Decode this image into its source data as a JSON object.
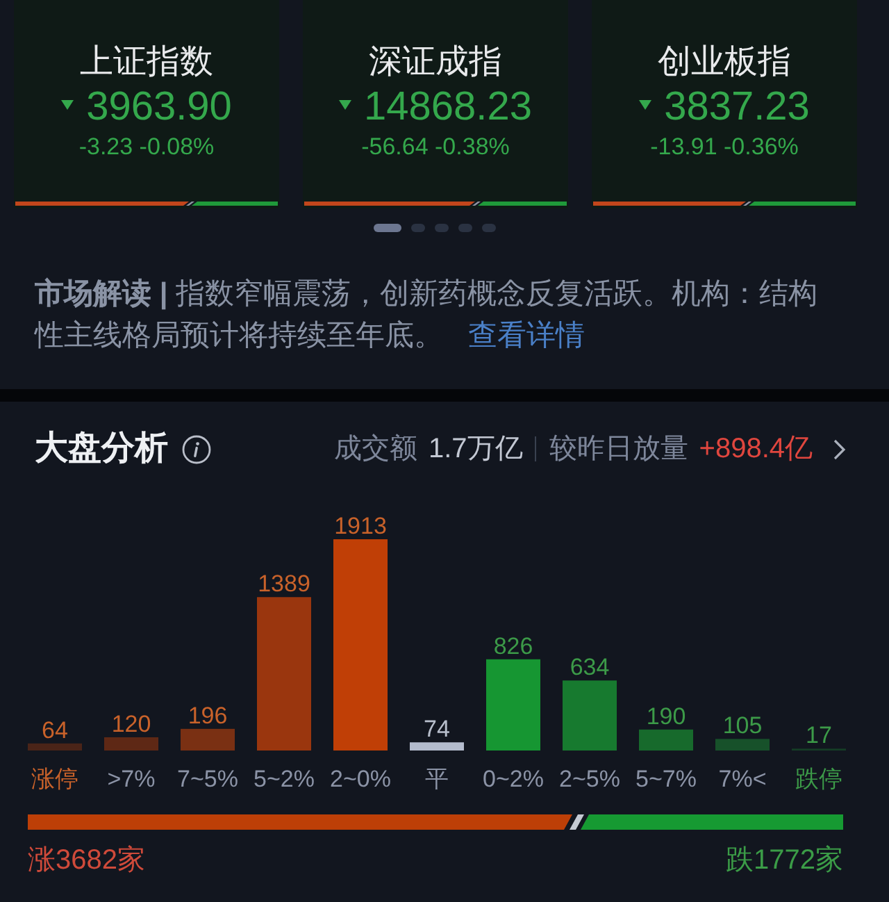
{
  "index_cards": [
    {
      "name": "上证指数",
      "value": "3963.90",
      "change": "-3.23 -0.08%",
      "falling": true,
      "level": 0.66
    },
    {
      "name": "深证成指",
      "value": "14868.23",
      "change": "-56.64 -0.38%",
      "falling": true,
      "level": 0.65
    },
    {
      "name": "创业板指",
      "value": "3837.23",
      "change": "-13.91 -0.36%",
      "falling": true,
      "level": 0.58
    }
  ],
  "pager": [
    {
      "selected": true
    },
    {
      "selected": false
    },
    {
      "selected": false
    },
    {
      "selected": false
    },
    {
      "selected": false
    }
  ],
  "market_commentary": {
    "text": "**市场解读 |** 指数窄幅震荡，创新药概念反复活跃。机构：结构性主线格局预计将持续至年底。",
    "link": "查看详情"
  },
  "market_analysis": {
    "title": "大盘分析",
    "turnover_label": "成交额",
    "turnover": "1.7万亿",
    "change_label": "较昨日放量",
    "change": "+898.4亿",
    "chart_data": {
      "type": "bar",
      "categories": [
        "涨停",
        ">7%",
        "7~5%",
        "5~2%",
        "2~0%",
        "平",
        "0~2%",
        "2~5%",
        "5~7%",
        "7%<",
        "跌停"
      ],
      "values": [
        64,
        120,
        196,
        1389,
        1913,
        74,
        826,
        634,
        190,
        105,
        17
      ],
      "data_labels": true
    },
    "bars": [
      {
        "kind": "up",
        "color": "#4a2418",
        "highlight": true
      },
      {
        "kind": "up",
        "color": "#5e2815",
        "highlight": false
      },
      {
        "kind": "up",
        "color": "#7a3013",
        "highlight": false
      },
      {
        "kind": "up",
        "color": "#9a360e",
        "highlight": false
      },
      {
        "kind": "up",
        "color": "#c03f06",
        "highlight": false
      },
      {
        "kind": "flat",
        "color": "#b4bccd",
        "highlight": false
      },
      {
        "kind": "down",
        "color": "#169632",
        "highlight": false
      },
      {
        "kind": "down",
        "color": "#177a2f",
        "highlight": false
      },
      {
        "kind": "down",
        "color": "#176a2c",
        "highlight": false
      },
      {
        "kind": "down",
        "color": "#17512a",
        "highlight": false
      },
      {
        "kind": "down",
        "color": "#153d26",
        "highlight": true
      }
    ],
    "breadth": {
      "level": 0.67,
      "rising": "涨3682家",
      "falling": "跌1772家"
    }
  }
}
